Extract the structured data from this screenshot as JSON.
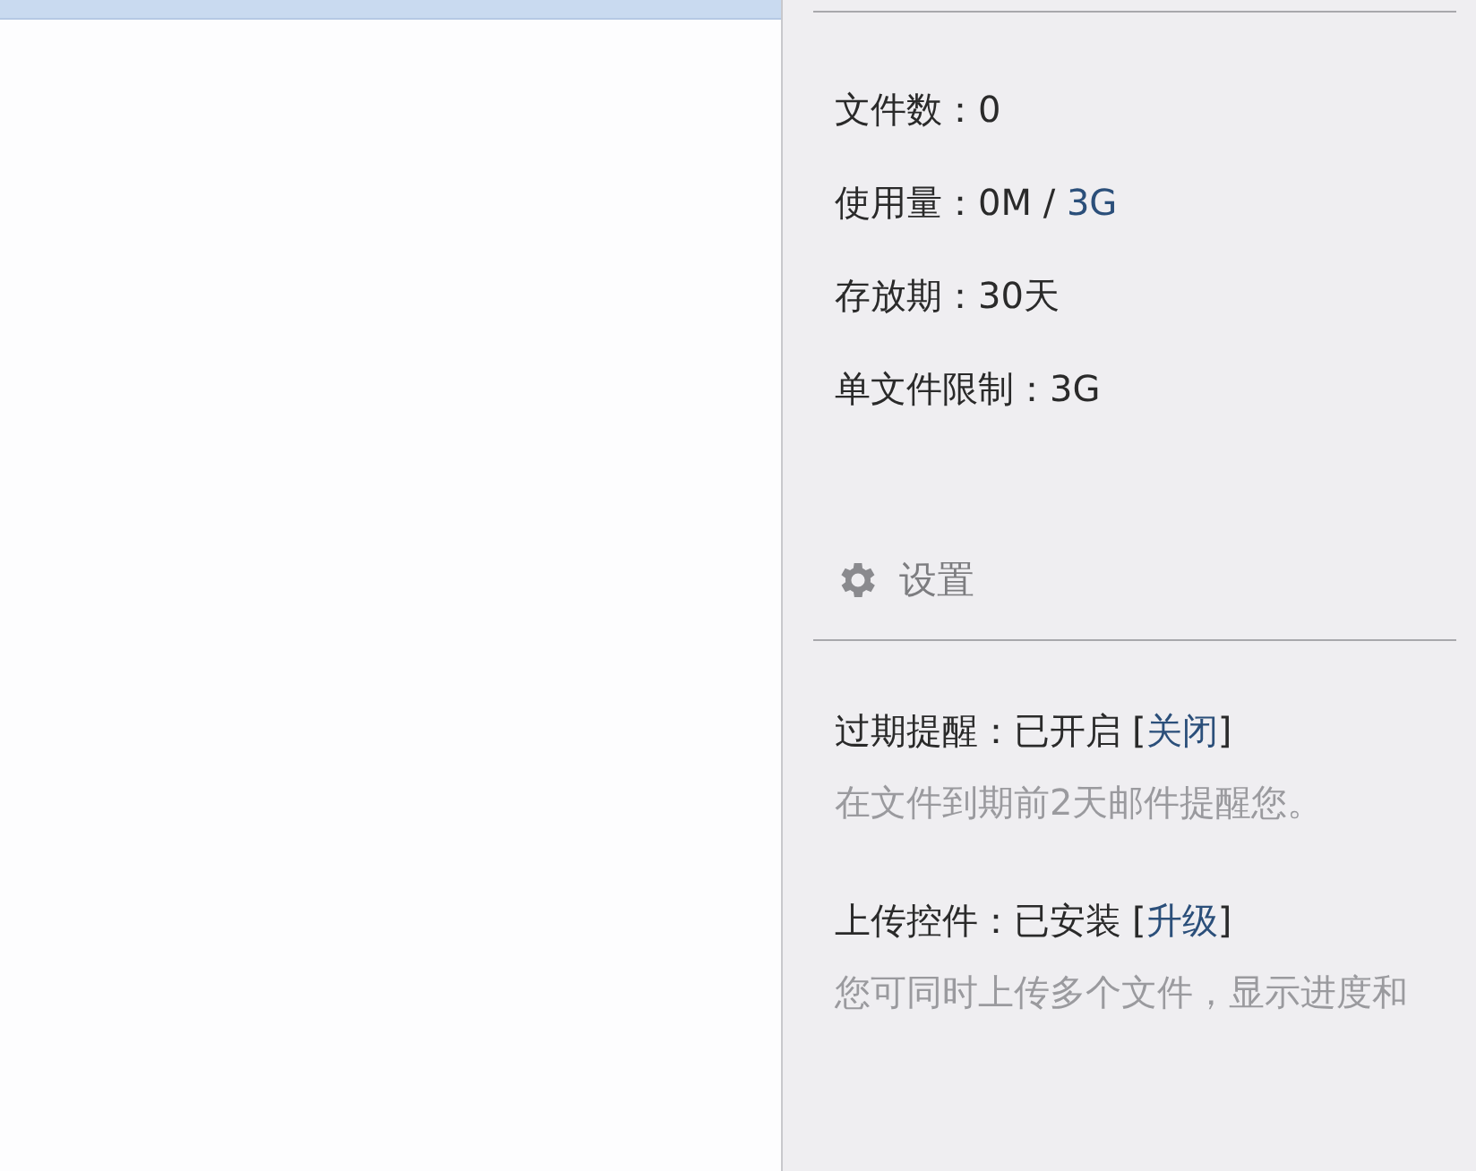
{
  "stats": [
    {
      "label": "文件数：",
      "value": "0"
    },
    {
      "label": "使用量：",
      "value": "0M / ",
      "link": "3G"
    },
    {
      "label": "存放期：",
      "value": "30天"
    },
    {
      "label": "单文件限制：",
      "value": "3G"
    }
  ],
  "settings": {
    "heading": "设置",
    "items": [
      {
        "label": "过期提醒：",
        "status": "已开启",
        "bracket_open": "[",
        "action": "关闭",
        "bracket_close": "]",
        "note": "在文件到期前2天邮件提醒您。"
      },
      {
        "label": "上传控件：",
        "status": "已安装",
        "bracket_open": "[",
        "action": "升级",
        "bracket_close": "]",
        "note": "您可同时上传多个文件，显示进度和"
      }
    ]
  }
}
